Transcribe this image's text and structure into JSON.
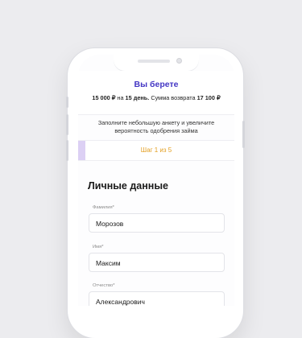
{
  "summary": {
    "title": "Вы берете",
    "amount": "15 000 ₽",
    "on": "на",
    "days": "15 день.",
    "return_label": "Сумма возврата",
    "return_amount": "17 100 ₽"
  },
  "hint": "Заполните небольшую анкету и увеличите вероятность одобрения займа",
  "stepper": {
    "label": "Шаг 1 из 5",
    "current": 1,
    "total": 5
  },
  "form": {
    "title": "Личные данные",
    "fields": [
      {
        "label": "Фамилия*",
        "value": "Морозов"
      },
      {
        "label": "Имя*",
        "value": "Максим"
      },
      {
        "label": "Отчество*",
        "value": "Александрович"
      }
    ]
  },
  "colors": {
    "accent": "#4336c4",
    "step": "#e39f22",
    "progress": "#dcd0f4"
  }
}
